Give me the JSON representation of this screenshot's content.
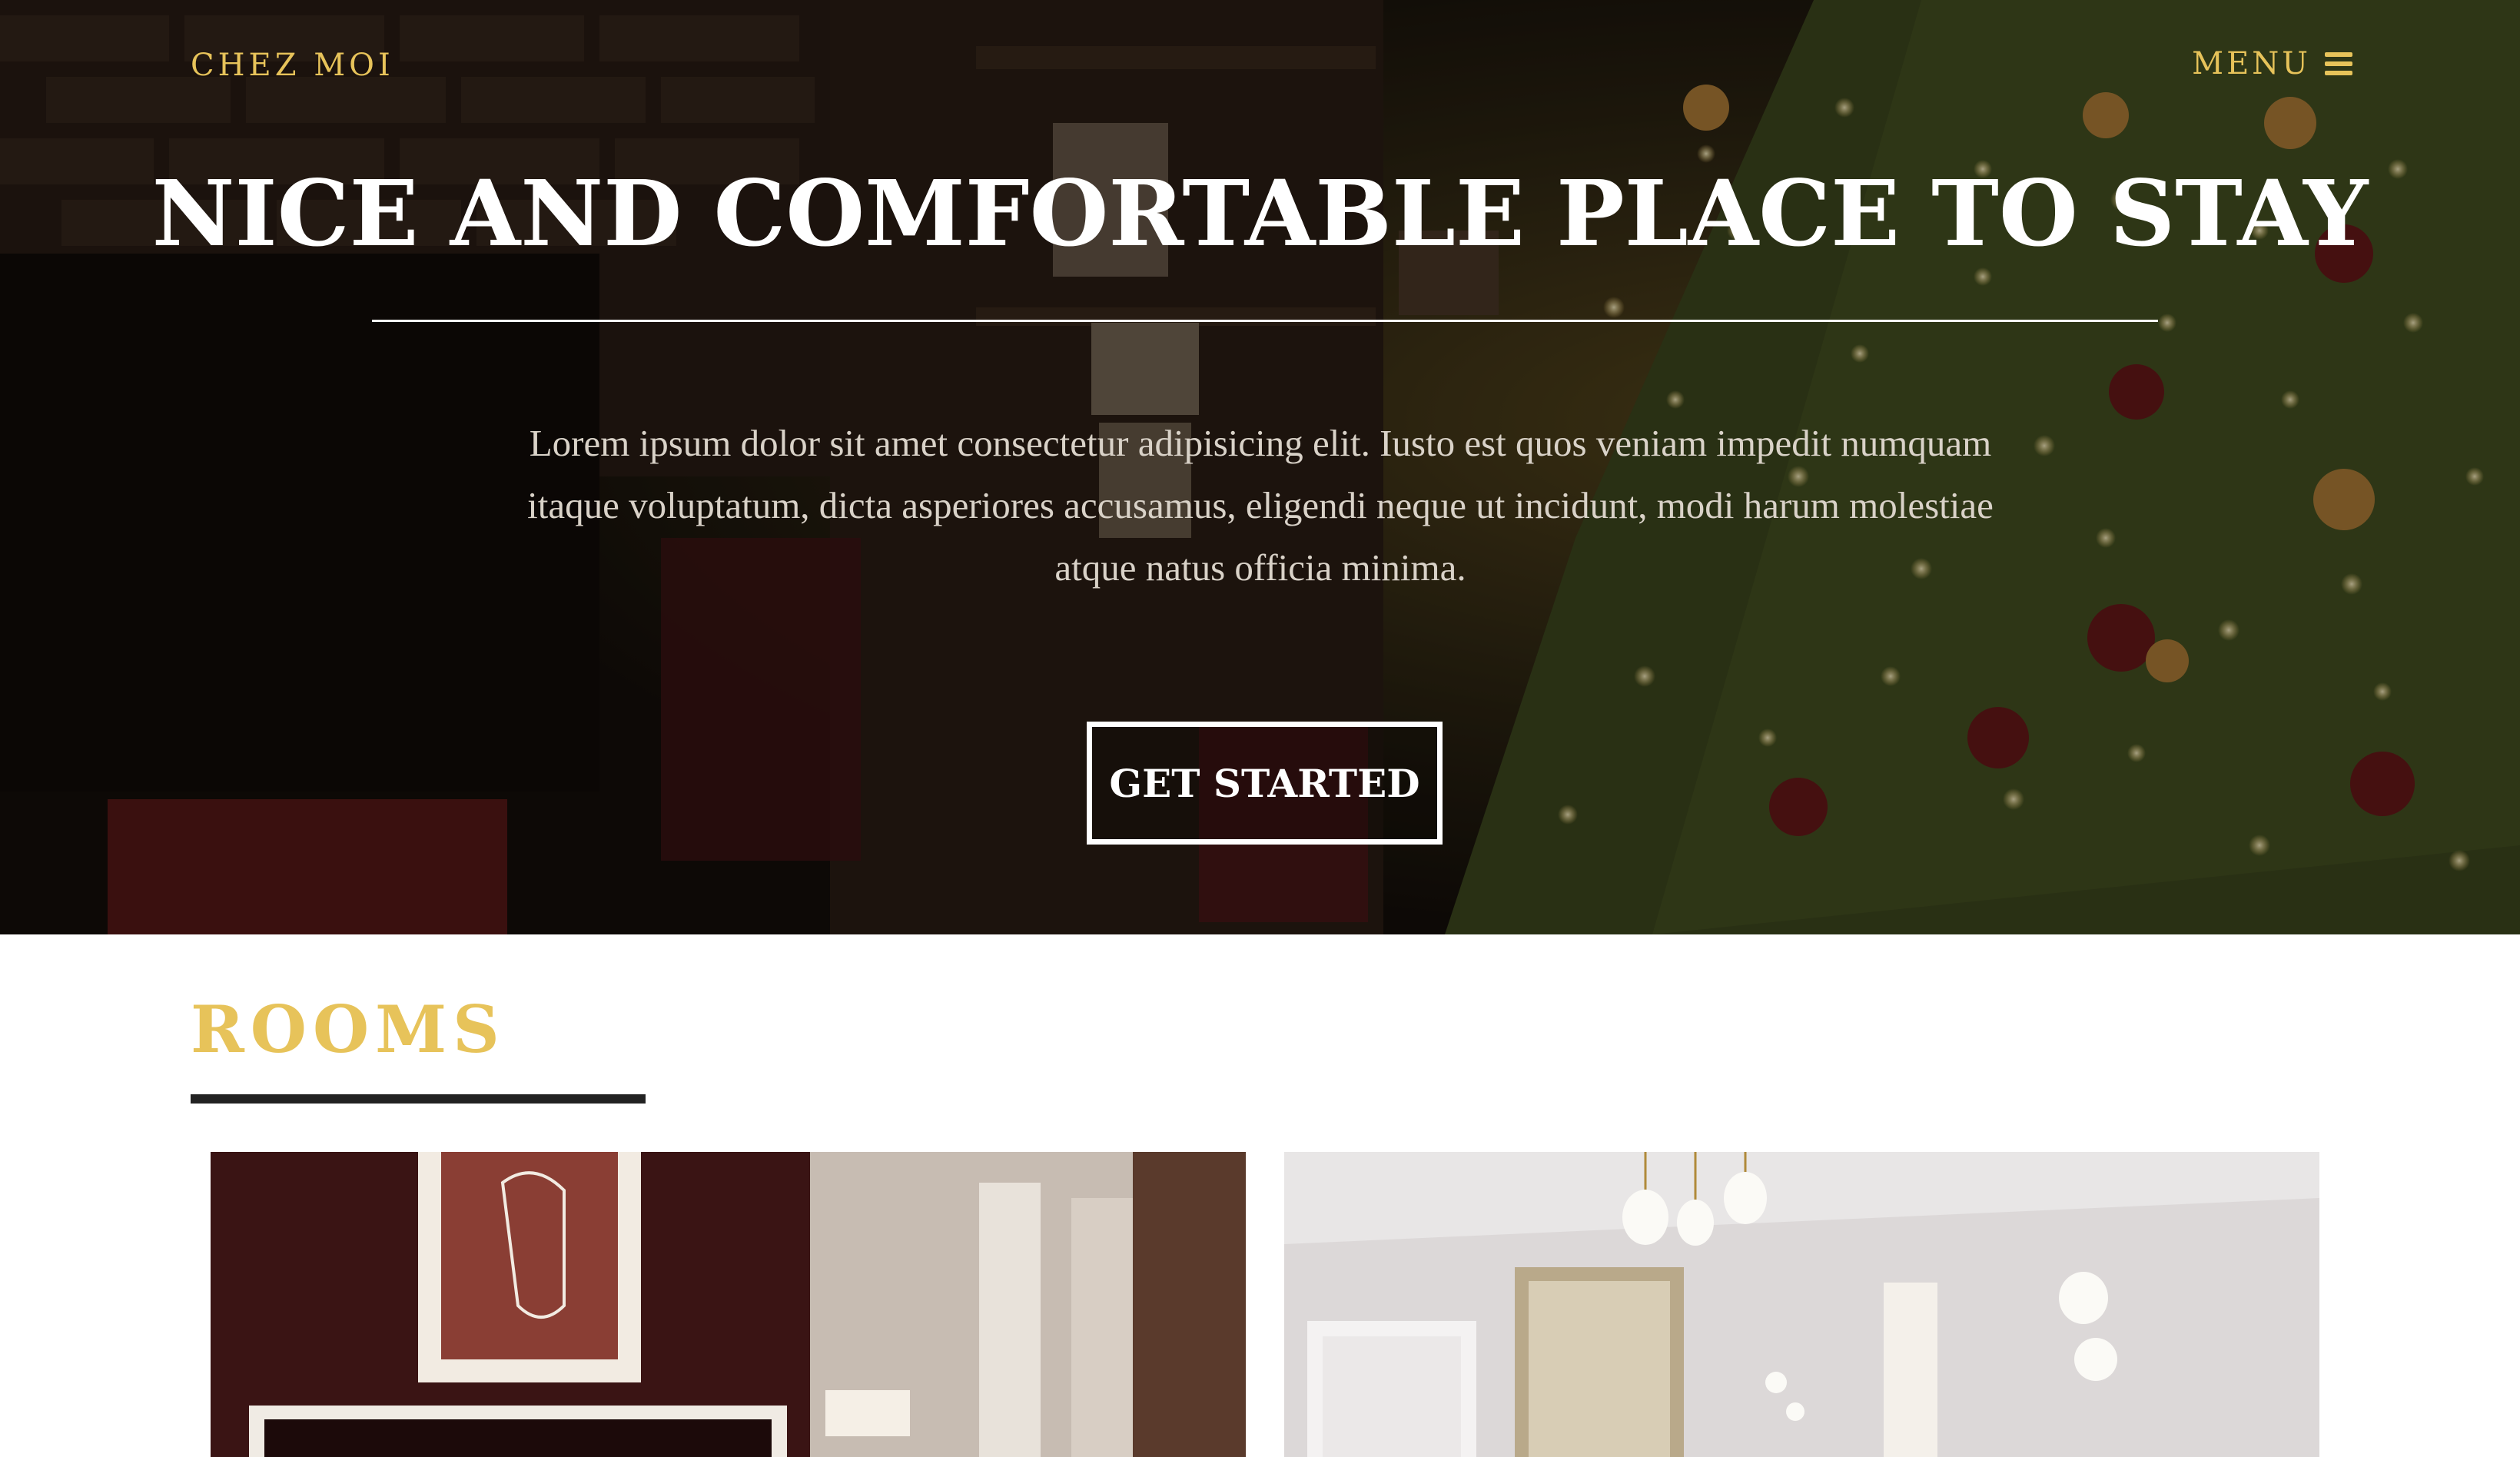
{
  "nav": {
    "brand": "CHEZ MOI",
    "menu_label": "MENU",
    "menu_icon": "hamburger-icon"
  },
  "hero": {
    "title": "NICE AND COMFORTABLE PLACE TO STAY",
    "text": "Lorem ipsum dolor sit amet consectetur adipisicing elit. Iusto est quos veniam impedit numquam itaque voluptatum, dicta asperiores accusamus, eligendi neque ut incidunt, modi harum molestiae atque natus officia minima.",
    "cta_label": "GET STARTED"
  },
  "rooms": {
    "title": "ROOMS"
  },
  "colors": {
    "accent": "#e7c35a",
    "dark": "#222222"
  }
}
